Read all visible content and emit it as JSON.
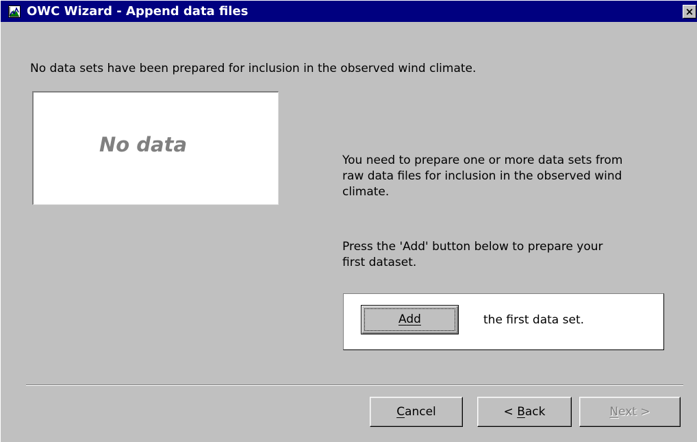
{
  "window": {
    "title": "OWC Wizard - Append data files",
    "close_glyph": "×",
    "colors": {
      "titlebar": "#000080",
      "face": "#c0c0c0",
      "disabled_text": "#808080"
    }
  },
  "intro": {
    "text": "No data sets have been prepared for inclusion in the observed wind climate."
  },
  "preview": {
    "placeholder": "No data"
  },
  "instructions": {
    "prepare_text": "You need to prepare one or more data sets from\nraw data files for inclusion in the observed wind\nclimate.",
    "press_add_text": "Press the 'Add' button below to prepare your\nfirst dataset."
  },
  "add_panel": {
    "button": {
      "mnemonic": "A",
      "rest": "dd"
    },
    "suffix": "the first data set."
  },
  "footer": {
    "cancel": {
      "mnemonic": "C",
      "rest": "ancel",
      "enabled": true
    },
    "back": {
      "prefix": "< ",
      "mnemonic": "B",
      "rest": "ack",
      "enabled": true
    },
    "next": {
      "mnemonic": "N",
      "rest": "ext >",
      "enabled": false
    }
  },
  "icons": {
    "app": "owc-chart-icon",
    "close": "close-icon"
  }
}
